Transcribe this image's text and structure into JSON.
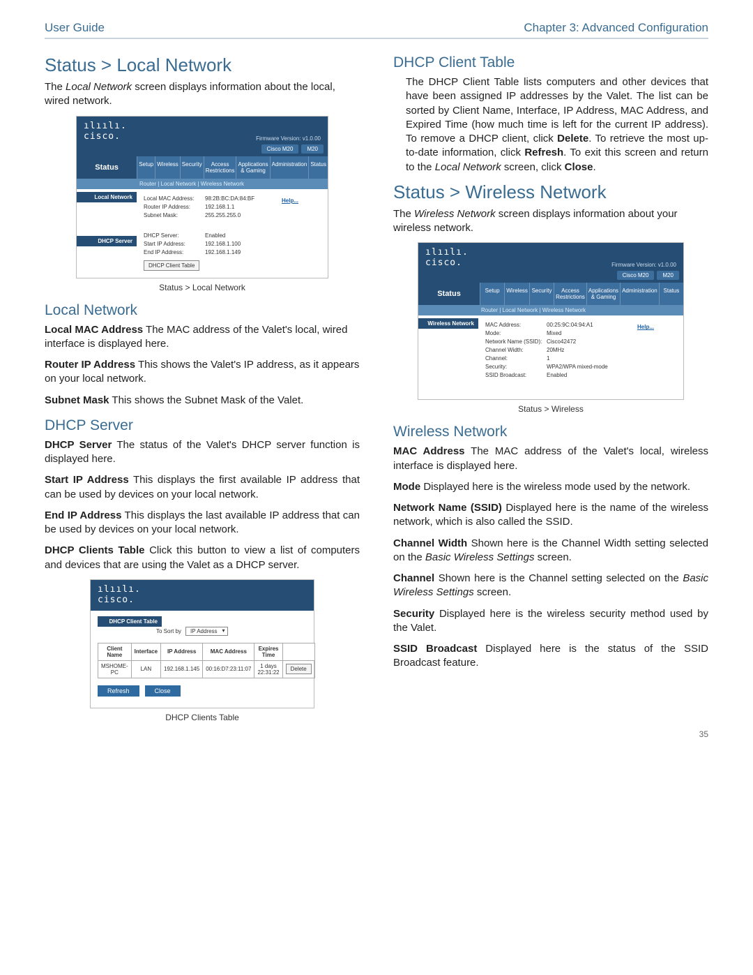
{
  "header": {
    "left": "User Guide",
    "right": "Chapter 3: Advanced Configuration"
  },
  "page_number": "35",
  "left": {
    "h1": "Status > Local Network",
    "intro_a": "The ",
    "intro_i": "Local Network",
    "intro_b": " screen displays information about the local, wired network.",
    "caption1": "Status > Local Network",
    "h2_local": "Local Network",
    "lmac_b": "Local MAC Address",
    "lmac_t": "  The MAC address of the Valet's local, wired interface is displayed here.",
    "rip_b": "Router IP Address",
    "rip_t": "  This shows the Valet's IP address, as it appears on your local network.",
    "sub_b": "Subnet Mask",
    "sub_t": "  This shows the Subnet Mask of the Valet.",
    "h2_dhcp": "DHCP Server",
    "dserv_b": "DHCP Server",
    "dserv_t": " The status of the Valet's DHCP server function is displayed here.",
    "sip_b": "Start IP Address",
    "sip_t": "  This displays the first available IP address that can be used by devices on your local network.",
    "eip_b": "End IP Address",
    "eip_t": "  This displays the last available IP address that can be used by devices on your local network.",
    "dct_b": "DHCP Clients Table",
    "dct_t": " Click this button to view a list of computers and devices that are using the Valet as a DHCP server.",
    "caption2": "DHCP Clients Table"
  },
  "right": {
    "h2_dct": "DHCP Client Table",
    "dct_p1": "The DHCP Client Table lists computers and other devices that have been assigned IP addresses by the Valet. The list can be sorted by Client Name, Interface, IP Address, MAC Address, and Expired Time (how much time is left for the current IP address). To remove a DHCP client, click ",
    "dct_b1": "Delete",
    "dct_p2": ". To retrieve the most up-to-date information, click ",
    "dct_b2": "Refresh",
    "dct_p3": ". To exit this screen and return to the ",
    "dct_i": "Local Network",
    "dct_p4": " screen, click ",
    "dct_b3": "Close",
    "dct_p5": ".",
    "h1_w": "Status > Wireless Network",
    "w_intro_a": "The ",
    "w_intro_i": "Wireless Network",
    "w_intro_b": " screen displays information about your wireless network.",
    "caption3": "Status > Wireless",
    "h2_wnet": "Wireless Network",
    "mac_b": "MAC Address",
    "mac_t": " The MAC address of the Valet's local, wireless interface is displayed here.",
    "mode_b": "Mode",
    "mode_t": "  Displayed here is the wireless mode used by the network.",
    "ssid_b": "Network Name (SSID)",
    "ssid_t": "  Displayed here is the name of the wireless network, which is also called the SSID.",
    "cw_b": "Channel Width",
    "cw_t": "  Shown here is the Channel Width setting selected on the ",
    "cw_i": "Basic Wireless Settings",
    "cw_t2": " screen.",
    "ch_b": "Channel",
    "ch_t": "  Shown here is the Channel setting selected on the ",
    "ch_i": "Basic Wireless Settings",
    "ch_t2": " screen.",
    "sec_b": "Security",
    "sec_t": "  Displayed here is the wireless security method used by the Valet.",
    "sb_b": "SSID Broadcast",
    "sb_t": "  Displayed here is the status of the SSID Broadcast feature."
  },
  "shot_common": {
    "cisco_logo_top": "ılıılı.",
    "cisco_logo_bot": "cisco.",
    "firmware": "Firmware Version: v1.0.00",
    "model": "Cisco M20",
    "model_short": "M20",
    "status_label": "Status",
    "tabs": [
      "Setup",
      "Wireless",
      "Security",
      "Access Restrictions",
      "Applications & Gaming",
      "Administration",
      "Status"
    ],
    "help": "Help..."
  },
  "shot1": {
    "subtabs": "Router   |   Local Network   |   Wireless Network",
    "side1": "Local Network",
    "side2": "DHCP Server",
    "kv": [
      {
        "k": "Local MAC Address:",
        "v": "98:2B:BC:DA:84:BF"
      },
      {
        "k": "Router IP Address:",
        "v": "192.168.1.1"
      },
      {
        "k": "Subnet Mask:",
        "v": "255.255.255.0"
      }
    ],
    "kv2": [
      {
        "k": "DHCP Server:",
        "v": "Enabled"
      },
      {
        "k": "Start IP Address:",
        "v": "192.168.1.100"
      },
      {
        "k": "End IP Address:",
        "v": "192.168.1.149"
      }
    ],
    "btn": "DHCP Client Table"
  },
  "shot2": {
    "side": "DHCP Client Table",
    "sort_label": "To Sort by",
    "sort_value": "IP Address",
    "th": [
      "Client Name",
      "Interface",
      "IP Address",
      "MAC Address",
      "Expires Time",
      ""
    ],
    "row": [
      "MSHOME-PC",
      "LAN",
      "192.168.1.145",
      "00:16:D7:23:11:07",
      "1 days 22:31:22",
      "Delete"
    ],
    "refresh": "Refresh",
    "close": "Close"
  },
  "shot3": {
    "subtabs": "Router   |   Local Network   |   Wireless Network",
    "side": "Wireless Network",
    "kv": [
      {
        "k": "MAC Address:",
        "v": "00:25:9C:04:94:A1"
      },
      {
        "k": "Mode:",
        "v": "Mixed"
      },
      {
        "k": "Network Name (SSID):",
        "v": "Cisco42472"
      },
      {
        "k": "Channel Width:",
        "v": "20MHz"
      },
      {
        "k": "Channel:",
        "v": "1"
      },
      {
        "k": "Security:",
        "v": "WPA2/WPA mixed-mode"
      },
      {
        "k": "SSID Broadcast:",
        "v": "Enabled"
      }
    ]
  }
}
